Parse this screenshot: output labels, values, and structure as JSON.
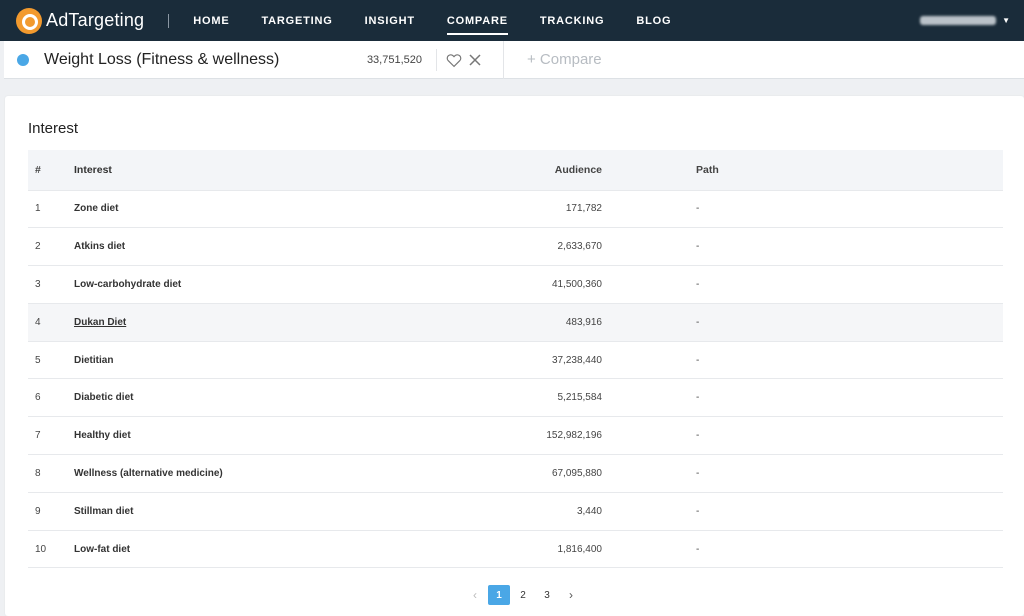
{
  "brand": {
    "name": "AdTargeting"
  },
  "nav": {
    "items": [
      {
        "label": "HOME",
        "active": false
      },
      {
        "label": "TARGETING",
        "active": false
      },
      {
        "label": "INSIGHT",
        "active": false
      },
      {
        "label": "COMPARE",
        "active": true
      },
      {
        "label": "TRACKING",
        "active": false
      },
      {
        "label": "BLOG",
        "active": false
      }
    ],
    "user_caret": "▼"
  },
  "compare_bar": {
    "dot_color": "#4aa7e6",
    "title": "Weight Loss (Fitness & wellness)",
    "count": "33,751,520",
    "add_label": "+ Compare"
  },
  "card": {
    "title": "Interest",
    "columns": {
      "num": "#",
      "interest": "Interest",
      "audience": "Audience",
      "path": "Path"
    },
    "rows": [
      {
        "num": "1",
        "interest": "Zone diet",
        "audience": "171,782",
        "path": "-"
      },
      {
        "num": "2",
        "interest": "Atkins diet",
        "audience": "2,633,670",
        "path": "-"
      },
      {
        "num": "3",
        "interest": "Low-carbohydrate diet",
        "audience": "41,500,360",
        "path": "-"
      },
      {
        "num": "4",
        "interest": "Dukan Diet",
        "audience": "483,916",
        "path": "-",
        "hovered": true
      },
      {
        "num": "5",
        "interest": "Dietitian",
        "audience": "37,238,440",
        "path": "-"
      },
      {
        "num": "6",
        "interest": "Diabetic diet",
        "audience": "5,215,584",
        "path": "-"
      },
      {
        "num": "7",
        "interest": "Healthy diet",
        "audience": "152,982,196",
        "path": "-"
      },
      {
        "num": "8",
        "interest": "Wellness (alternative medicine)",
        "audience": "67,095,880",
        "path": "-"
      },
      {
        "num": "9",
        "interest": "Stillman diet",
        "audience": "3,440",
        "path": "-"
      },
      {
        "num": "10",
        "interest": "Low-fat diet",
        "audience": "1,816,400",
        "path": "-"
      }
    ]
  },
  "pagination": {
    "prev": "‹",
    "pages": [
      "1",
      "2",
      "3"
    ],
    "current": "1",
    "next": "›"
  },
  "colors": {
    "nav_bg": "#1a2c3a",
    "accent": "#4aa7e6",
    "logo": "#f29a2e"
  },
  "icons": {
    "heart": "heart-icon",
    "close": "close-icon",
    "logo": "logo-icon"
  }
}
